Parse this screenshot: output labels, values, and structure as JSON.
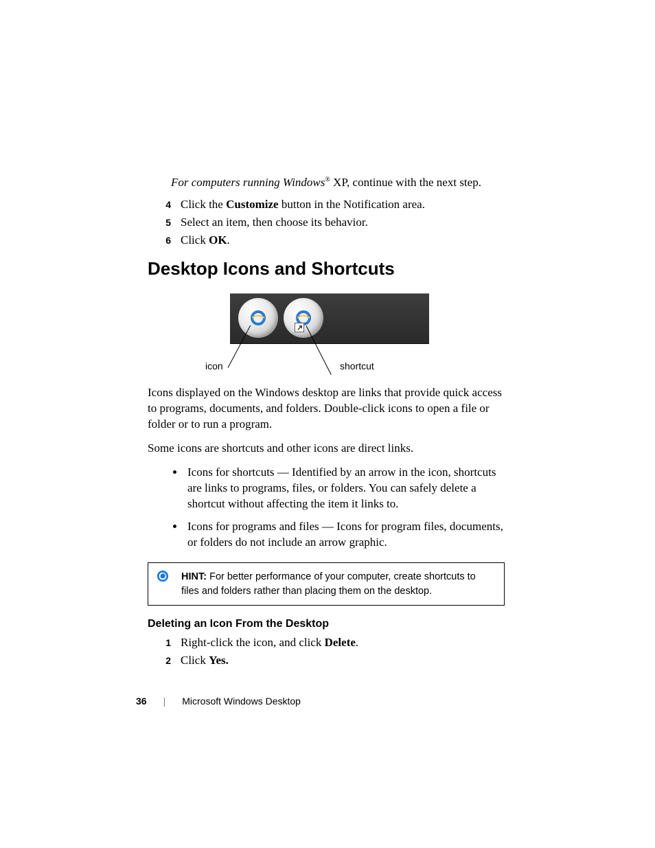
{
  "intro": {
    "italic_prefix": "For computers running Windows",
    "reg_mark": "®",
    "rest": " XP, continue with the next step."
  },
  "steps_a": [
    {
      "n": "4",
      "pre": "Click the ",
      "bold": "Customize",
      "post": " button in the Notification area."
    },
    {
      "n": "5",
      "pre": "Select an item, then choose its behavior.",
      "bold": "",
      "post": ""
    },
    {
      "n": "6",
      "pre": "Click ",
      "bold": "OK",
      "post": "."
    }
  ],
  "heading": "Desktop Icons and Shortcuts",
  "figure": {
    "label_icon": "icon",
    "label_shortcut": "shortcut"
  },
  "para1": "Icons displayed on the Windows desktop are links that provide quick access to programs, documents, and folders. Double-click icons to open a file or folder or to run a program.",
  "para2": "Some icons are shortcuts and other icons are direct links.",
  "bullets": [
    "Icons for shortcuts — Identified by an arrow in the icon, shortcuts are links to programs, files, or folders. You can safely delete a shortcut without affecting the item it links to.",
    "Icons for programs and files — Icons for program files, documents, or folders do not include an arrow graphic."
  ],
  "hint": {
    "label": "HINT:",
    "text": " For better performance of your computer, create shortcuts to files and folders rather than placing them on the desktop."
  },
  "subheading": "Deleting an Icon From the Desktop",
  "steps_b": [
    {
      "n": "1",
      "pre": "Right-click the icon, and click ",
      "bold": "Delete",
      "post": "."
    },
    {
      "n": "2",
      "pre": "Click ",
      "bold": "Yes.",
      "post": ""
    }
  ],
  "footer": {
    "page": "36",
    "title": "Microsoft Windows Desktop"
  }
}
